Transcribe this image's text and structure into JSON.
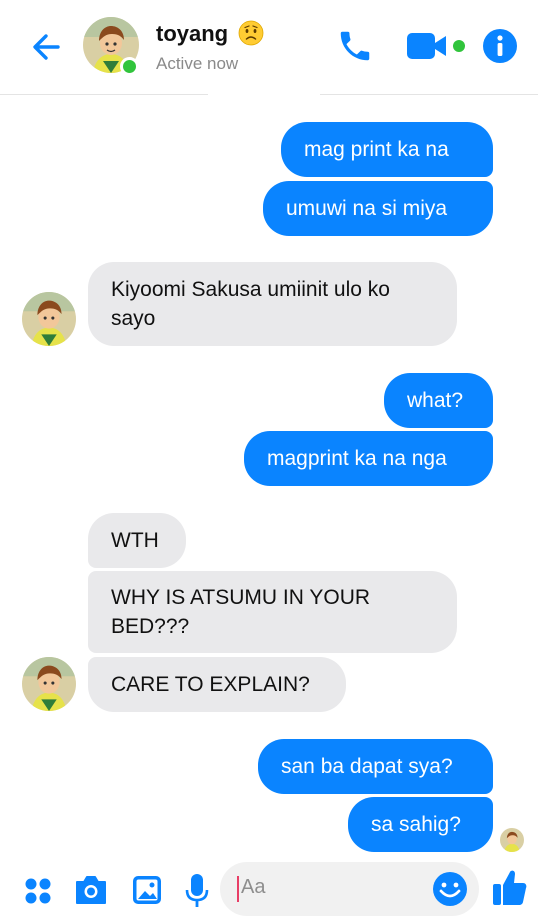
{
  "header": {
    "contact_name": "toyang",
    "status": "Active now",
    "accent": "#0a84ff",
    "online_color": "#31c43c",
    "icons": [
      "back-arrow-icon",
      "phone-icon",
      "video-camera-icon",
      "info-icon"
    ]
  },
  "messages": [
    {
      "side": "out",
      "text": "mag print ka na"
    },
    {
      "side": "out",
      "text": "umuwi na si miya"
    },
    {
      "side": "in",
      "text": "Kiyoomi Sakusa umiinit ulo ko sayo"
    },
    {
      "side": "out",
      "text": "what?"
    },
    {
      "side": "out",
      "text": "magprint ka na nga"
    },
    {
      "side": "in",
      "text": "WTH"
    },
    {
      "side": "in",
      "text": "WHY IS ATSUMU IN YOUR BED???"
    },
    {
      "side": "in",
      "text": "CARE TO EXPLAIN?"
    },
    {
      "side": "out",
      "text": "san ba dapat sya?"
    },
    {
      "side": "out",
      "text": "sa sahig?"
    }
  ],
  "composer": {
    "placeholder": "Aa",
    "icons": [
      "apps-icon",
      "camera-icon",
      "gallery-icon",
      "microphone-icon",
      "emoji-icon",
      "thumbs-up-icon"
    ]
  }
}
